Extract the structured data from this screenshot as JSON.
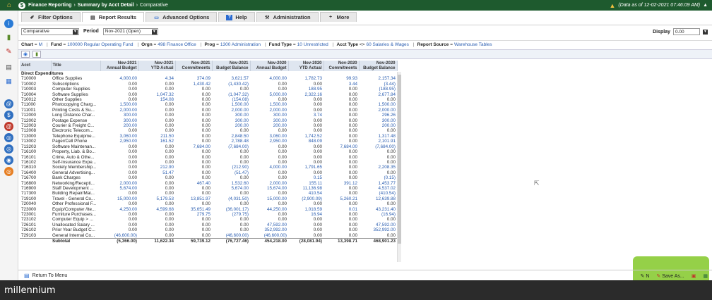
{
  "titlebar": {
    "crumbs": [
      "Finance Reporting",
      "Summary by Acct Detail",
      "Comparative"
    ],
    "sep": "›",
    "data_as_of": "(Data as of 12-02-2021 07:46:09 AM)"
  },
  "tabs": [
    {
      "label": "Filter Options",
      "icon": "pencil-icon"
    },
    {
      "label": "Report Results",
      "icon": "report-icon"
    },
    {
      "label": "Advanced Options",
      "icon": "options-icon"
    },
    {
      "label": "Help",
      "icon": "help-icon"
    },
    {
      "label": "Administration",
      "icon": "wrench-icon"
    },
    {
      "label": "More",
      "icon": "plus-icon"
    }
  ],
  "filter": {
    "report_type": "Comparative",
    "period_label": "Period",
    "period_value": "Nov-2021 (Open)",
    "display_label": "Display",
    "display_value": "0.00"
  },
  "criteria": [
    {
      "label": "Chart",
      "value": "M"
    },
    {
      "label": "Fund",
      "value": "100000 Regular Operating Fund"
    },
    {
      "label": "Orgn",
      "value": "498 Finance Office"
    },
    {
      "label": "Prog",
      "value": "1300 Administration"
    },
    {
      "label": "Fund Type",
      "value": "10 Unrestricted"
    },
    {
      "label": "Acct Type",
      "op": "<>",
      "value": "60 Salaries & Wages"
    },
    {
      "label": "Report Source",
      "value": "Warehouse Tables"
    }
  ],
  "table": {
    "headers": [
      {
        "l1": "Acct",
        "l2": ""
      },
      {
        "l1": "Title",
        "l2": ""
      },
      {
        "l1": "Nov-2021",
        "l2": "Annual Budget"
      },
      {
        "l1": "Nov-2021",
        "l2": "YTD Actual"
      },
      {
        "l1": "Nov-2021",
        "l2": "Commitments"
      },
      {
        "l1": "Nov-2021",
        "l2": "Budget Balance"
      },
      {
        "l1": "Nov-2020",
        "l2": "Annual Budget"
      },
      {
        "l1": "Nov-2020",
        "l2": "YTD Actual"
      },
      {
        "l1": "Nov-2020",
        "l2": "Commitments"
      },
      {
        "l1": "Nov-2020",
        "l2": "Budget Balance"
      }
    ],
    "section": "Direct Expenditures",
    "rows": [
      [
        "710000",
        "Office Supplies",
        "4,000.00",
        "4.34",
        "374.09",
        "3,621.57",
        "4,000.00",
        "1,782.73",
        "99.93",
        "2,157.34"
      ],
      [
        "710002",
        "Subscriptions",
        "0.00",
        "0.00",
        "1,430.42",
        "(1,430.42)",
        "0.00",
        "0.00",
        "3.44",
        "(3.44)"
      ],
      [
        "710003",
        "Computer Supplies",
        "0.00",
        "0.00",
        "0.00",
        "0.00",
        "0.00",
        "188.95",
        "0.00",
        "(188.95)"
      ],
      [
        "710004",
        "Software Supplies",
        "0.00",
        "1,047.32",
        "0.00",
        "(1,047.32)",
        "5,000.00",
        "2,322.16",
        "0.00",
        "2,677.84"
      ],
      [
        "710012",
        "Other Supplies",
        "0.00",
        "154.08",
        "0.00",
        "(154.08)",
        "0.00",
        "0.00",
        "0.00",
        "0.00"
      ],
      [
        "711000",
        "Photocopying Charg...",
        "1,500.00",
        "0.00",
        "0.00",
        "1,500.00",
        "1,500.00",
        "0.00",
        "0.00",
        "1,500.00"
      ],
      [
        "711001",
        "Printing Costs & Su...",
        "2,000.00",
        "0.00",
        "0.00",
        "2,000.00",
        "2,000.00",
        "0.00",
        "0.00",
        "2,000.00"
      ],
      [
        "712000",
        "Long Distance Char...",
        "300.00",
        "0.00",
        "0.00",
        "300.00",
        "300.00",
        "3.74",
        "0.00",
        "296.26"
      ],
      [
        "712002",
        "Postage Expense",
        "300.00",
        "0.00",
        "0.00",
        "300.00",
        "300.00",
        "0.00",
        "0.00",
        "300.00"
      ],
      [
        "712003",
        "Courier & Freight C...",
        "200.00",
        "0.00",
        "0.00",
        "200.00",
        "200.00",
        "0.00",
        "0.00",
        "200.00"
      ],
      [
        "712008",
        "Electronic Telecom...",
        "0.00",
        "0.00",
        "0.00",
        "0.00",
        "0.00",
        "0.00",
        "0.00",
        "0.00"
      ],
      [
        "713000",
        "Telephone Equipme...",
        "3,060.00",
        "211.50",
        "0.00",
        "2,848.50",
        "3,060.00",
        "1,742.52",
        "0.00",
        "1,317.48"
      ],
      [
        "713002",
        "Pager/Cell Phone",
        "2,950.00",
        "161.52",
        "0.00",
        "2,788.48",
        "2,950.00",
        "848.09",
        "0.00",
        "2,101.91"
      ],
      [
        "713203",
        "Software Maintenan...",
        "0.00",
        "0.00",
        "7,684.00",
        "(7,684.00)",
        "0.00",
        "0.00",
        "7,684.00",
        "(7,684.00)"
      ],
      [
        "716100",
        "Property, Liab. & Bo...",
        "0.00",
        "0.00",
        "0.00",
        "0.00",
        "0.00",
        "0.00",
        "0.00",
        "0.00"
      ],
      [
        "716101",
        "Crime, Auto & Othe...",
        "0.00",
        "0.00",
        "0.00",
        "0.00",
        "0.00",
        "0.00",
        "0.00",
        "0.00"
      ],
      [
        "716102",
        "Self-Insurance Expe...",
        "0.00",
        "0.00",
        "0.00",
        "0.00",
        "0.00",
        "0.00",
        "0.00",
        "0.00"
      ],
      [
        "716310",
        "Society Membership...",
        "0.00",
        "212.90",
        "0.00",
        "(212.90)",
        "4,000.00",
        "1,791.65",
        "0.00",
        "2,208.35"
      ],
      [
        "716400",
        "General Advertising...",
        "0.00",
        "51.47",
        "0.00",
        "(51.47)",
        "0.00",
        "0.00",
        "0.00",
        "0.00"
      ],
      [
        "716700",
        "Bank Charges",
        "0.00",
        "0.00",
        "0.00",
        "0.00",
        "0.00",
        "0.15",
        "0.00",
        "(0.15)"
      ],
      [
        "716800",
        "Networking/Recepti...",
        "2,000.00",
        "0.00",
        "467.40",
        "1,532.60",
        "2,000.00",
        "155.11",
        "391.12",
        "1,453.77"
      ],
      [
        "716900",
        "Staff Development ...",
        "5,674.00",
        "0.00",
        "0.00",
        "5,674.00",
        "15,674.00",
        "11,136.98",
        "0.00",
        "4,537.02"
      ],
      [
        "717300",
        "Building Repair/Mai...",
        "0.00",
        "0.00",
        "0.00",
        "0.00",
        "0.00",
        "410.54",
        "0.00",
        "(410.54)"
      ],
      [
        "719100",
        "Travel - General Co...",
        "15,000.00",
        "5,179.53",
        "13,851.97",
        "(4,031.50)",
        "15,000.00",
        "(2,900.09)",
        "5,260.21",
        "12,639.88"
      ],
      [
        "720040",
        "Other Professional F...",
        "0.00",
        "0.00",
        "0.00",
        "0.00",
        "0.00",
        "0.00",
        "0.00",
        "0.00"
      ],
      [
        "723000",
        "Equip/Computer /Ite...",
        "4,250.00",
        "4,599.68",
        "35,651.49",
        "(36,001.17)",
        "44,250.00",
        "1,018.59",
        "0.01",
        "43,231.40"
      ],
      [
        "723001",
        "Furniture Purchases...",
        "0.00",
        "0.00",
        "279.75",
        "(279.75)",
        "0.00",
        "16.94",
        "0.00",
        "(16.94)"
      ],
      [
        "723102",
        "Computer Equip > ...",
        "0.00",
        "0.00",
        "0.00",
        "0.00",
        "0.00",
        "0.00",
        "0.00",
        "0.00"
      ],
      [
        "726101",
        "Unallocated Salary ...",
        "0.00",
        "0.00",
        "0.00",
        "0.00",
        "47,592.00",
        "0.00",
        "0.00",
        "47,592.00"
      ],
      [
        "726102",
        "Prior Year Budget C...",
        "0.00",
        "0.00",
        "0.00",
        "0.00",
        "352,992.00",
        "0.00",
        "0.00",
        "352,992.00"
      ],
      [
        "729103",
        "General Internal Co...",
        "(46,600.00)",
        "0.00",
        "0.00",
        "(46,600.00)",
        "(46,600.00)",
        "0.00",
        "0.00",
        "0.00"
      ]
    ],
    "subtotal": [
      "",
      "Subtotal",
      "(5,366.00)",
      "11,622.34",
      "59,739.12",
      "(76,727.46)",
      "454,218.00",
      "(28,081.94)",
      "13,398.71",
      "468,901.23"
    ]
  },
  "bottom": {
    "return_label": "Return To Menu",
    "note_label": "N",
    "save_label": "Save As..."
  },
  "footer": {
    "brand": "millennium"
  }
}
